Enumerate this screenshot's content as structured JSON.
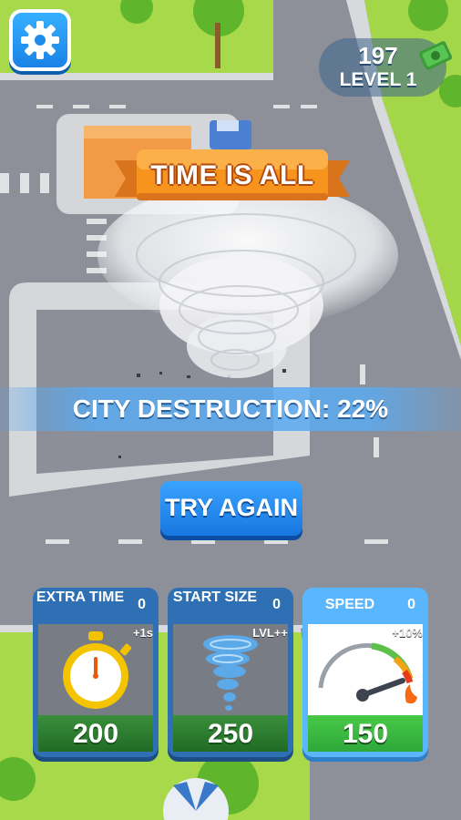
{
  "hud": {
    "currency": "197",
    "level": "LEVEL 1",
    "settings_icon": "gear-icon",
    "currency_icon": "cash-icon"
  },
  "banner": {
    "text": "TIME IS ALL"
  },
  "destruction": {
    "text": "CITY DESTRUCTION: 22%",
    "percent": 22
  },
  "try_again": {
    "label": "TRY AGAIN"
  },
  "upgrades": [
    {
      "title": "EXTRA TIME",
      "count": "0",
      "tag": "+1s",
      "price": "200",
      "icon": "stopwatch-icon"
    },
    {
      "title": "START SIZE",
      "count": "0",
      "tag": "LVL++",
      "price": "250",
      "icon": "tornado-icon"
    },
    {
      "title": "SPEED",
      "count": "0",
      "tag": "+10%",
      "price": "150",
      "icon": "speedometer-icon"
    }
  ],
  "colors": {
    "accent_blue": "#1a82e6",
    "banner_orange": "#f7941d",
    "price_green": "#2ea83a"
  }
}
